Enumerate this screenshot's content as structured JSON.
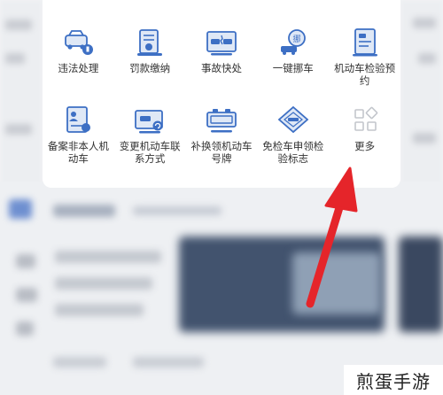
{
  "services": {
    "row1": [
      {
        "label": "违法处理",
        "icon": "car-badge-icon"
      },
      {
        "label": "罚款缴纳",
        "icon": "receipt-yen-icon"
      },
      {
        "label": "事故快处",
        "icon": "car-collision-icon"
      },
      {
        "label": "一键挪车",
        "icon": "move-car-icon"
      },
      {
        "label": "机动车检验预约",
        "icon": "inspection-booking-icon"
      }
    ],
    "row2": [
      {
        "label": "备案非本人机动车",
        "icon": "person-file-icon"
      },
      {
        "label": "变更机动车联系方式",
        "icon": "change-contact-icon"
      },
      {
        "label": "补换领机动车号牌",
        "icon": "license-plate-icon"
      },
      {
        "label": "免检车申领检验标志",
        "icon": "exempt-diamond-icon"
      },
      {
        "label": "更多",
        "icon": "more-grid-icon"
      }
    ]
  },
  "watermark": {
    "text": "煎蛋手游"
  },
  "colors": {
    "icon_blue": "#3d6fc4",
    "icon_light": "#dfe8f6",
    "arrow_red": "#e5252a",
    "text": "#333333"
  }
}
